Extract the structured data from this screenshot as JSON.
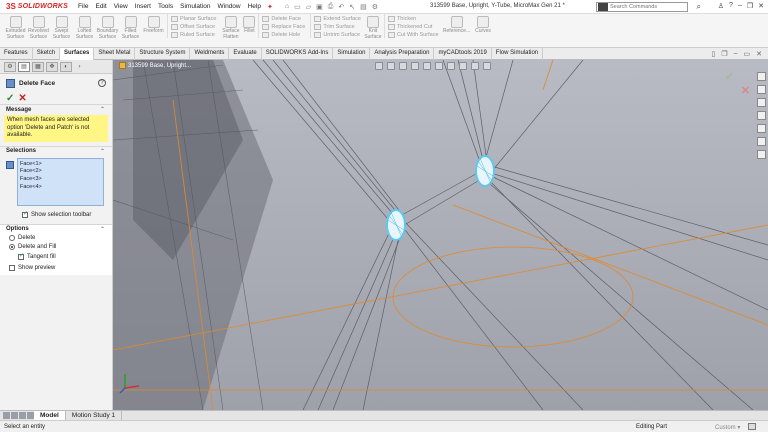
{
  "app": {
    "logo_mark": "3S",
    "logo_text": "SOLIDWORKS",
    "menu": [
      "File",
      "Edit",
      "View",
      "Insert",
      "Tools",
      "Simulation",
      "Window",
      "Help"
    ],
    "doc_title": "313599 Base, Upright, Y-Tube, MicroMax Gen 21 *",
    "search_placeholder": "Search Commands"
  },
  "ribbon": {
    "tools": [
      {
        "label": "Extruded Surface"
      },
      {
        "label": "Revolved Surface"
      },
      {
        "label": "Swept Surface"
      },
      {
        "label": "Lofted Surface"
      },
      {
        "label": "Boundary Surface"
      },
      {
        "label": "Filled Surface"
      },
      {
        "label": "Freeform"
      }
    ],
    "group1": [
      "Planar Surface",
      "Offset Surface",
      "Ruled Surface"
    ],
    "flatten": "Surface Flatten",
    "fillet": "Fillet",
    "group2": [
      "Delete Face",
      "Replace Face",
      "Delete Hole"
    ],
    "group3": [
      "Extend Surface",
      "Trim Surface",
      "Untrim Surface"
    ],
    "knit": "Knit Surface",
    "group4": [
      "Thicken",
      "Thickened Cut",
      "Cut With Surface"
    ],
    "reference": "Reference...",
    "curves": "Curves"
  },
  "tabs": [
    "Features",
    "Sketch",
    "Surfaces",
    "Sheet Metal",
    "Structure System",
    "Weldments",
    "Evaluate",
    "SOLIDWORKS Add-Ins",
    "Simulation",
    "Analysis Preparation",
    "myCADtools 2019",
    "Flow Simulation"
  ],
  "active_tab": "Surfaces",
  "property_manager": {
    "title": "Delete Face",
    "message_heading": "Message",
    "message": "When mesh faces are selected option 'Delete and Patch' is not available.",
    "selections_heading": "Selections",
    "selections": [
      "Face<1>",
      "Face<2>",
      "Face<3>",
      "Face<4>"
    ],
    "show_selection_toolbar": "Show selection toolbar",
    "options_heading": "Options",
    "option_delete": "Delete",
    "option_delete_and_fill": "Delete and Fill",
    "option_tangent_fill": "Tangent fill",
    "option_show_preview": "Show preview"
  },
  "viewport": {
    "tree_label": "313599 Base, Upright..."
  },
  "bottom_tabs": [
    "Model",
    "Motion Study 1"
  ],
  "status": {
    "left": "Select an entity",
    "editing": "Editing Part",
    "units": "Custom"
  },
  "colors": {
    "viewport_bg": "#a4a6b0",
    "accent_orange": "#e08a2a",
    "mesh_highlight": "#5ec8ee"
  }
}
